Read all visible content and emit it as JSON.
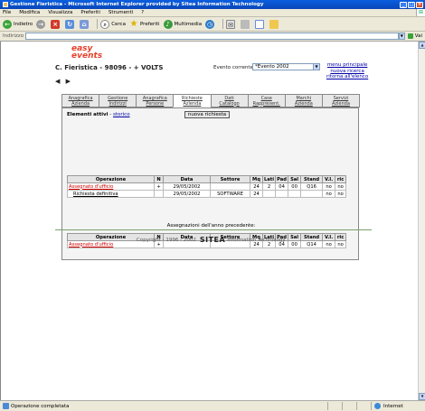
{
  "window": {
    "title": "Gestione Fieristica - Microsoft Internet Explorer provided by Sitea Information Technology"
  },
  "menubar": {
    "items": [
      "File",
      "Modifica",
      "Visualizza",
      "Preferiti",
      "Strumenti",
      "?"
    ]
  },
  "toolbar": {
    "back": "Indietro",
    "search": "Cerca",
    "favorites": "Preferiti",
    "media": "Multimedia"
  },
  "address": {
    "label": "Indirizzo",
    "go": "Vai"
  },
  "page": {
    "logo": [
      "easy",
      "events"
    ],
    "fiera_title": "C. Fieristica - 98096 - + VOLTS",
    "nav_arrows": "◀ ▶",
    "evento_label": "Evento corrente:",
    "evento_value": "*Evento 2002",
    "links": [
      "menu principale",
      "nuova ricerca",
      "ritorna all'elenco"
    ],
    "tabs": [
      [
        "Anagrafica",
        "Azienda"
      ],
      [
        "Gestione",
        "Indirizzi"
      ],
      [
        "Anagrafica",
        "Persone"
      ],
      [
        "Richieste",
        "Azienda"
      ],
      [
        "Dati",
        "Catalogo"
      ],
      [
        "Case",
        "Rappresent."
      ],
      [
        "Marchi",
        "Azienda"
      ],
      [
        "Servizi",
        "Azienda"
      ]
    ],
    "elementi_label": "Elementi attivi",
    "elementi_sep": " - ",
    "storico_link": "storico",
    "nuova_richiesta": "nuova richiesta",
    "table1": {
      "headers": [
        "Operazione",
        "N",
        "Data",
        "Settore",
        "Mq",
        "Lati",
        "Pad",
        "Sal",
        "Stand",
        "V.I.",
        "ric"
      ],
      "rows": [
        [
          "Assegnato d'ufficio",
          "+",
          "29/05/2002",
          "",
          "24",
          "2",
          "04",
          "00",
          "Q16",
          "no",
          "no"
        ],
        [
          "Richiesta definitiva",
          "",
          "29/05/2002",
          "SOFTWARE",
          "24",
          "",
          "",
          "",
          "",
          "no",
          "no"
        ]
      ]
    },
    "assegnazioni_label": "Assegnazioni dell'anno precedente:",
    "table2": {
      "headers": [
        "Operazione",
        "N",
        "Data",
        "Settore",
        "Mq",
        "Lati",
        "Pad",
        "Sal",
        "Stand",
        "V.I.",
        "ric"
      ],
      "rows": [
        [
          "Assegnato d'ufficio",
          "+",
          "",
          "",
          "24",
          "2",
          "04",
          "00",
          "Q14",
          "no",
          "no"
        ]
      ]
    },
    "footer_copyright": "Copyright - 1996 - 2002",
    "footer_brand": "SITEA",
    "footer_tagline": "Information Technology"
  },
  "status": {
    "text": "Operazione completata",
    "zone": "Internet"
  }
}
